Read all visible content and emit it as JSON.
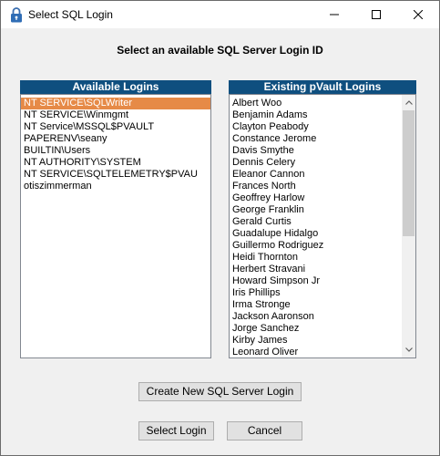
{
  "window": {
    "title": "Select SQL Login",
    "icon": "lock-icon"
  },
  "heading": "Select an available SQL Server Login ID",
  "available": {
    "title": "Available Logins",
    "items": [
      "NT SERVICE\\SQLWriter",
      "NT SERVICE\\Winmgmt",
      "NT Service\\MSSQL$PVAULT",
      "PAPERENV\\seany",
      "BUILTIN\\Users",
      "NT AUTHORITY\\SYSTEM",
      "NT SERVICE\\SQLTELEMETRY$PVAU",
      "otiszimmerman"
    ],
    "selected_index": 0
  },
  "existing": {
    "title": "Existing pVault Logins",
    "items": [
      "Albert Woo",
      "Benjamin Adams",
      "Clayton Peabody",
      "Constance Jerome",
      "Davis Smythe",
      "Dennis Celery",
      "Eleanor Cannon",
      "Frances North",
      "Geoffrey Harlow",
      "George Franklin",
      "Gerald Curtis",
      "Guadalupe Hidalgo",
      "Guillermo Rodriguez",
      "Heidi Thornton",
      "Herbert Stravani",
      "Howard Simpson Jr",
      "Iris Phillips",
      "Irma Stronge",
      "Jackson Aaronson",
      "Jorge Sanchez",
      "Kirby James",
      "Leonard Oliver"
    ]
  },
  "buttons": {
    "create": "Create New SQL Server Login",
    "select": "Select Login",
    "cancel": "Cancel"
  },
  "colors": {
    "header_bg": "#0f4f7f",
    "selection": "#e68a47"
  }
}
